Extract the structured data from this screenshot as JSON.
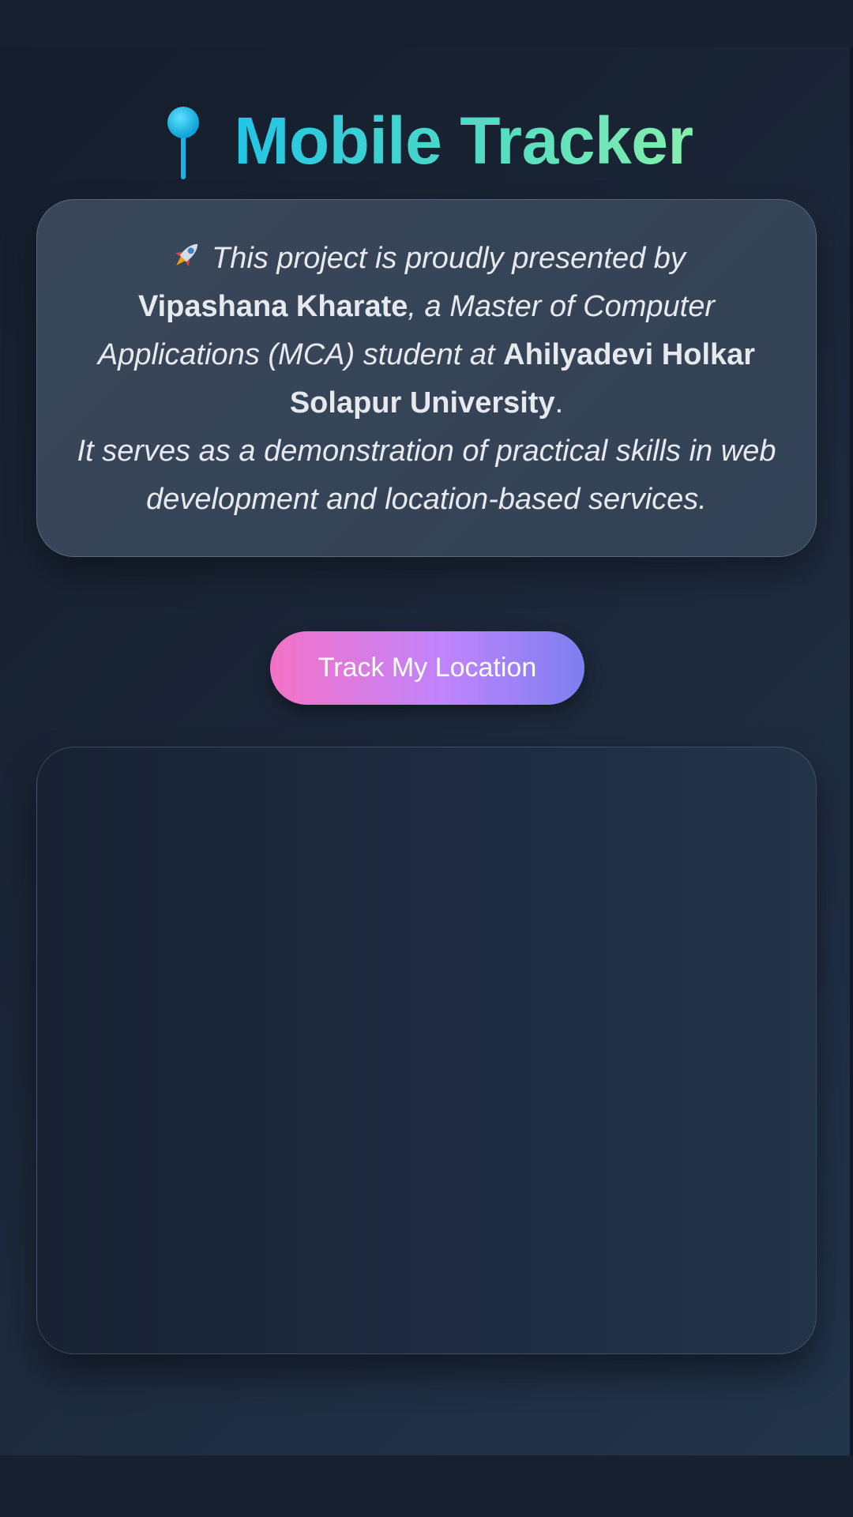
{
  "app": {
    "title": "Mobile Tracker",
    "pin_icon": "round-pushpin-icon",
    "title_gradient": [
      "#22c5e6",
      "#86efac"
    ]
  },
  "intro": {
    "rocket_icon": "rocket-icon",
    "text_1": "This project is proudly presented by",
    "presenter": "Vipashana Kharate",
    "text_2": ", a Master of Computer Applications (MCA) student at",
    "university": "Ahilyadevi Holkar Solapur University",
    "text_3": ".",
    "text_4": "It serves as a demonstration of practical skills in web development and location-based services."
  },
  "actions": {
    "track_label": "Track My Location",
    "button_gradient": [
      "#f472c6",
      "#7c7ff0"
    ]
  },
  "map": {
    "state": "empty"
  }
}
